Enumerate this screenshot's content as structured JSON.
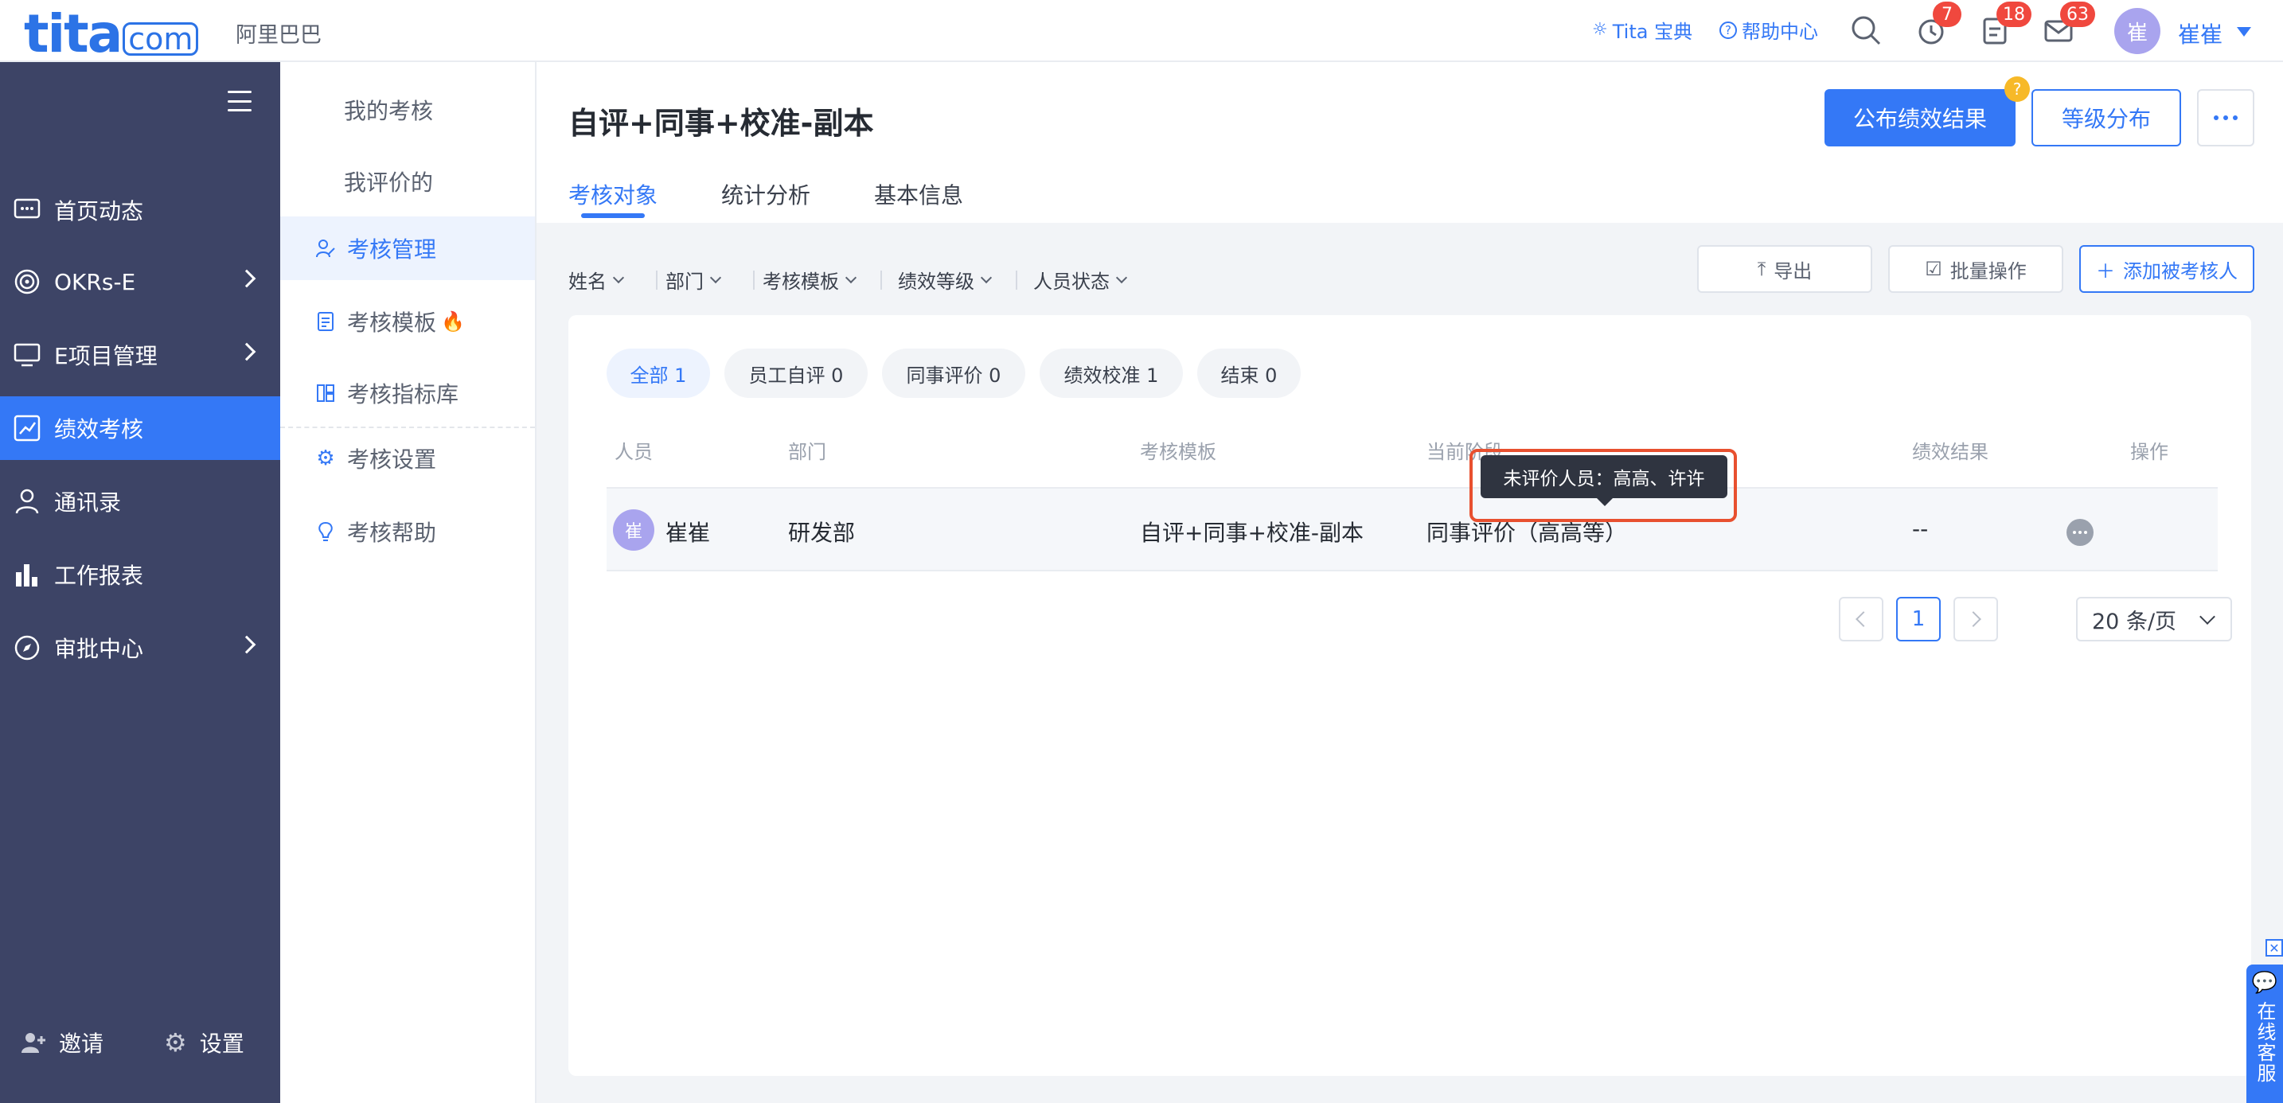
{
  "brand": {
    "logo_main": "tita",
    "logo_com": "com",
    "org_name": "阿里巴巴"
  },
  "topbar": {
    "link_baodian": "Tita 宝典",
    "link_help": "帮助中心",
    "badges": {
      "reminder": "7",
      "tasks": "18",
      "messages": "63"
    },
    "avatar_initial": "崔",
    "user_name": "崔崔"
  },
  "leftnav": {
    "items": [
      {
        "label": "首页动态",
        "icon": "chat-bubble-icon"
      },
      {
        "label": "OKRs-E",
        "icon": "target-icon"
      },
      {
        "label": "E项目管理",
        "icon": "monitor-icon"
      },
      {
        "label": "绩效考核",
        "icon": "chart-trend-icon"
      },
      {
        "label": "通讯录",
        "icon": "person-icon"
      },
      {
        "label": "工作报表",
        "icon": "bar-chart-icon"
      },
      {
        "label": "审批中心",
        "icon": "compass-icon"
      }
    ],
    "invite_label": "邀请",
    "settings_label": "设置"
  },
  "subnav": {
    "my_review": "我的考核",
    "i_reviewed": "我评价的",
    "manage": "考核管理",
    "template": "考核模板",
    "indicator": "考核指标库",
    "settings": "考核设置",
    "help": "考核帮助"
  },
  "main": {
    "title": "自评+同事+校准-副本",
    "tabs": [
      "考核对象",
      "统计分析",
      "基本信息"
    ],
    "publish_button": "公布绩效结果",
    "publish_help": "?",
    "level_button": "等级分布",
    "filters": [
      "姓名",
      "部门",
      "考核模板",
      "绩效等级",
      "人员状态"
    ],
    "export_button": "导出",
    "batch_button": "批量操作",
    "add_button": "添加被考核人",
    "pills": [
      "全部 1",
      "员工自评 0",
      "同事评价 0",
      "绩效校准 1",
      "结束 0"
    ],
    "columns": [
      "人员",
      "部门",
      "考核模板",
      "当前阶段",
      "绩效结果",
      "操作"
    ],
    "rows": [
      {
        "avatar": "崔",
        "name": "崔崔",
        "dept": "研发部",
        "template": "自评+同事+校准-副本",
        "stage": "同事评价（高高等）",
        "result": "--"
      }
    ],
    "tooltip": "未评价人员：高高、许许",
    "pager": {
      "current": "1",
      "page_size": "20 条/页"
    }
  },
  "chat_widget": {
    "label": "在线客服",
    "close": "✕"
  },
  "colors": {
    "primary": "#3478f6",
    "nav_bg": "#3d4466",
    "badge": "#f0483e",
    "highlight": "#e8502f"
  }
}
